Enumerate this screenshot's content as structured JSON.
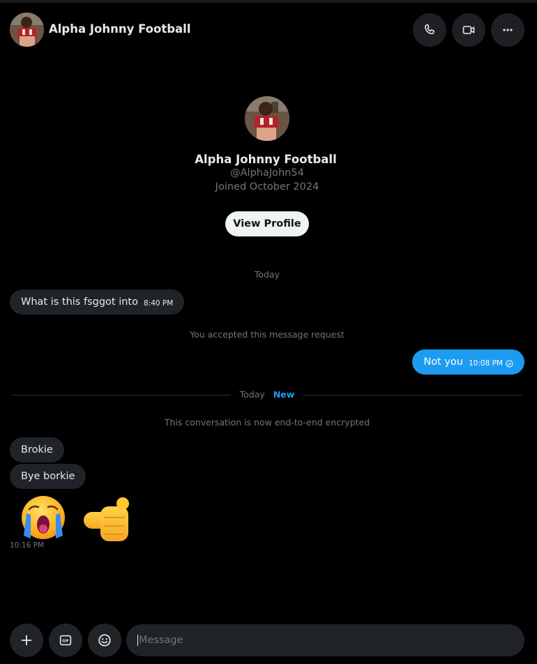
{
  "header": {
    "name": "Alpha Johnny Football",
    "call_icon": "phone-icon",
    "video_icon": "video-camera-icon",
    "more_icon": "more-horizontal-icon"
  },
  "profile": {
    "name": "Alpha Johnny Football",
    "handle": "@AlphaJohn54",
    "joined": "Joined October 2024",
    "view_profile_label": "View Profile"
  },
  "conversation": {
    "date_label_1": "Today",
    "messages_before": [
      {
        "direction": "in",
        "text": "What is this fsggot into",
        "time": "8:40 PM"
      }
    ],
    "request_note": "You accepted this message request",
    "reply": {
      "direction": "out",
      "text": "Not you",
      "time": "10:08 PM",
      "status_icon": "check-circle-icon"
    },
    "divider": {
      "today": "Today",
      "new": "New"
    },
    "encryption_note": "This conversation is now end-to-end encrypted",
    "messages_after": [
      {
        "direction": "in",
        "text": "Brokie"
      },
      {
        "direction": "in",
        "text": "Bye borkie"
      }
    ],
    "emojis": [
      "crying-face-emoji",
      "pointing-finger-emoji"
    ],
    "emoji_time": "10:16 PM"
  },
  "composer": {
    "add_icon": "plus-icon",
    "gif_icon": "gif-icon",
    "gif_label": "GIF",
    "emoji_icon": "smiley-icon",
    "placeholder": "Message"
  },
  "colors": {
    "background": "#000000",
    "accent": "#1d9bf0",
    "bubble_in": "#202327",
    "muted_text": "#71767b"
  }
}
